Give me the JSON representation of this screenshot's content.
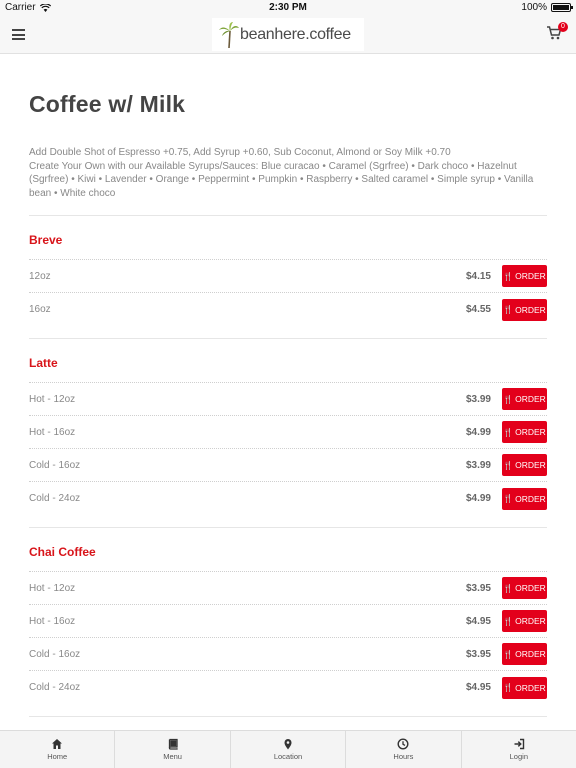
{
  "status_bar": {
    "carrier": "Carrier",
    "time": "2:30 PM",
    "battery": "100%"
  },
  "header": {
    "logo_text": "beanhere.coffee",
    "cart_count": "0"
  },
  "page": {
    "title": "Coffee w/ Milk",
    "description_lines": [
      "Add Double Shot of Espresso +0.75, Add Syrup +0.60, Sub Coconut, Almond or Soy Milk +0.70",
      "Create Your Own with our Available Syrups/Sauces: Blue curacao • Caramel (Sgrfree) • Dark choco • Hazelnut (Sgrfree) • Kiwi • Lavender • Orange • Peppermint • Pumpkin • Raspberry • Salted caramel • Simple syrup • Vanilla bean • White choco"
    ]
  },
  "order_label": "ORDER",
  "categories": [
    {
      "title": "Breve",
      "items": [
        {
          "name": "12oz",
          "price": "$4.15"
        },
        {
          "name": "16oz",
          "price": "$4.55"
        }
      ]
    },
    {
      "title": "Latte",
      "items": [
        {
          "name": "Hot - 12oz",
          "price": "$3.99"
        },
        {
          "name": "Hot - 16oz",
          "price": "$4.99"
        },
        {
          "name": "Cold - 16oz",
          "price": "$3.99"
        },
        {
          "name": "Cold - 24oz",
          "price": "$4.99"
        }
      ]
    },
    {
      "title": "Chai Coffee",
      "items": [
        {
          "name": "Hot - 12oz",
          "price": "$3.95"
        },
        {
          "name": "Hot - 16oz",
          "price": "$4.95"
        },
        {
          "name": "Cold - 16oz",
          "price": "$3.95"
        },
        {
          "name": "Cold - 24oz",
          "price": "$4.95"
        }
      ]
    }
  ],
  "bottom_nav": [
    {
      "label": "Home",
      "icon": "home-icon"
    },
    {
      "label": "Menu",
      "icon": "book-icon"
    },
    {
      "label": "Location",
      "icon": "map-pin-icon"
    },
    {
      "label": "Hours",
      "icon": "clock-icon"
    },
    {
      "label": "Login",
      "icon": "login-icon"
    }
  ],
  "colors": {
    "accent": "#e3001b",
    "category_title": "#d8141a"
  }
}
